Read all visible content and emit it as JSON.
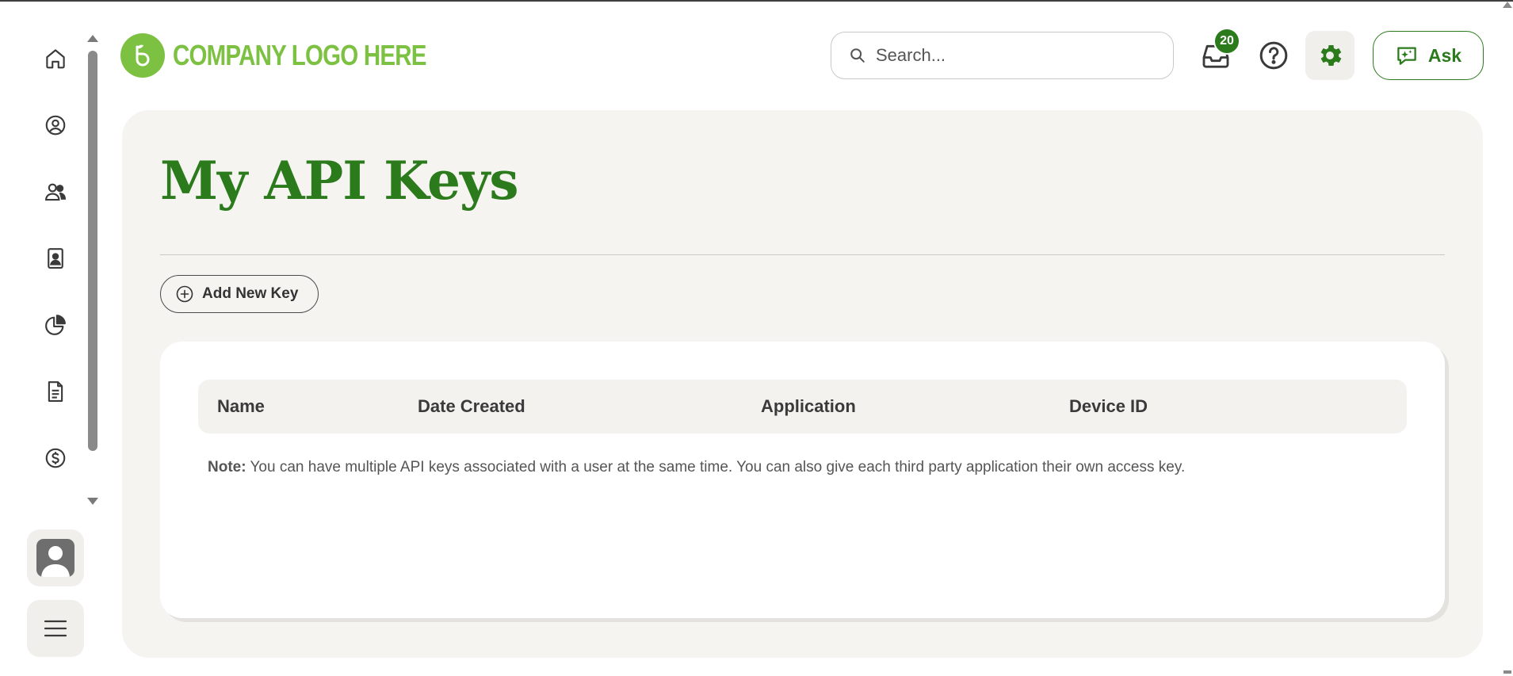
{
  "header": {
    "logo_text": "COMPANY LOGO HERE",
    "search_placeholder": "Search...",
    "inbox_badge": "20",
    "ask_label": "Ask"
  },
  "sidebar": {
    "items": [
      {
        "icon": "home-icon"
      },
      {
        "icon": "user-circle-icon"
      },
      {
        "icon": "users-icon"
      },
      {
        "icon": "contact-card-icon"
      },
      {
        "icon": "pie-chart-icon"
      },
      {
        "icon": "document-icon"
      },
      {
        "icon": "dollar-circle-icon"
      }
    ]
  },
  "main": {
    "title": "My API Keys",
    "add_key_label": "Add New Key",
    "table": {
      "columns": [
        "Name",
        "Date Created",
        "Application",
        "Device ID"
      ]
    },
    "note_label": "Note:",
    "note_text": "You can have multiple API keys associated with a user at the same time. You can also give each third party application their own access key."
  },
  "colors": {
    "brand_green": "#2b7a1c",
    "logo_green": "#7cc142",
    "panel_bg": "#f5f4f1"
  }
}
